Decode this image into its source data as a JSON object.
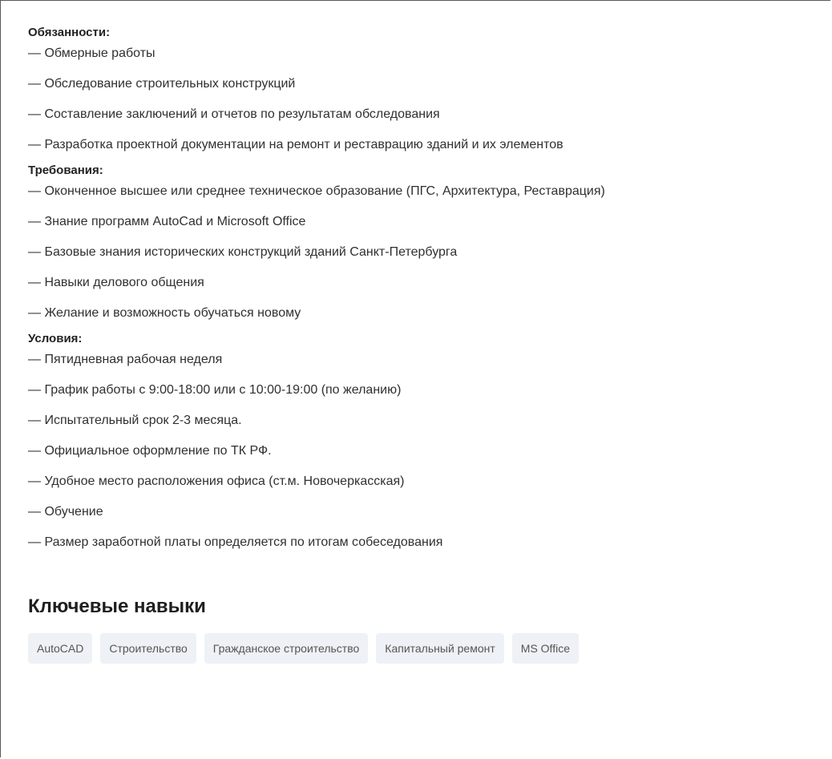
{
  "sections": [
    {
      "title": "Обязанности:",
      "items": [
        "— Обмерные работы",
        "— Обследование строительных конструкций",
        "— Составление заключений и отчетов по результатам обследования",
        "— Разработка проектной документации на ремонт и реставрацию зданий и их элементов"
      ]
    },
    {
      "title": "Требования:",
      "items": [
        "— Оконченное высшее или среднее техническое образование (ПГС, Архитектура, Реставрация)",
        "— Знание программ AutoCad и Microsoft Office",
        "— Базовые знания исторических конструкций зданий Санкт-Петербурга",
        "— Навыки делового общения",
        "— Желание и возможность обучаться новому"
      ]
    },
    {
      "title": "Условия:",
      "items": [
        "— Пятидневная рабочая неделя",
        "— График работы с 9:00-18:00 или с 10:00-19:00 (по желанию)",
        "— Испытательный срок 2-3 месяца.",
        "— Официальное оформление по ТК РФ.",
        "— Удобное место расположения офиса (ст.м. Новочеркасская)",
        "— Обучение",
        "— Размер заработной платы определяется по итогам собеседования"
      ]
    }
  ],
  "skills": {
    "heading": "Ключевые навыки",
    "tags": [
      "AutoCAD",
      "Строительство",
      "Гражданское строительство",
      "Капитальный ремонт",
      "MS Office"
    ]
  }
}
